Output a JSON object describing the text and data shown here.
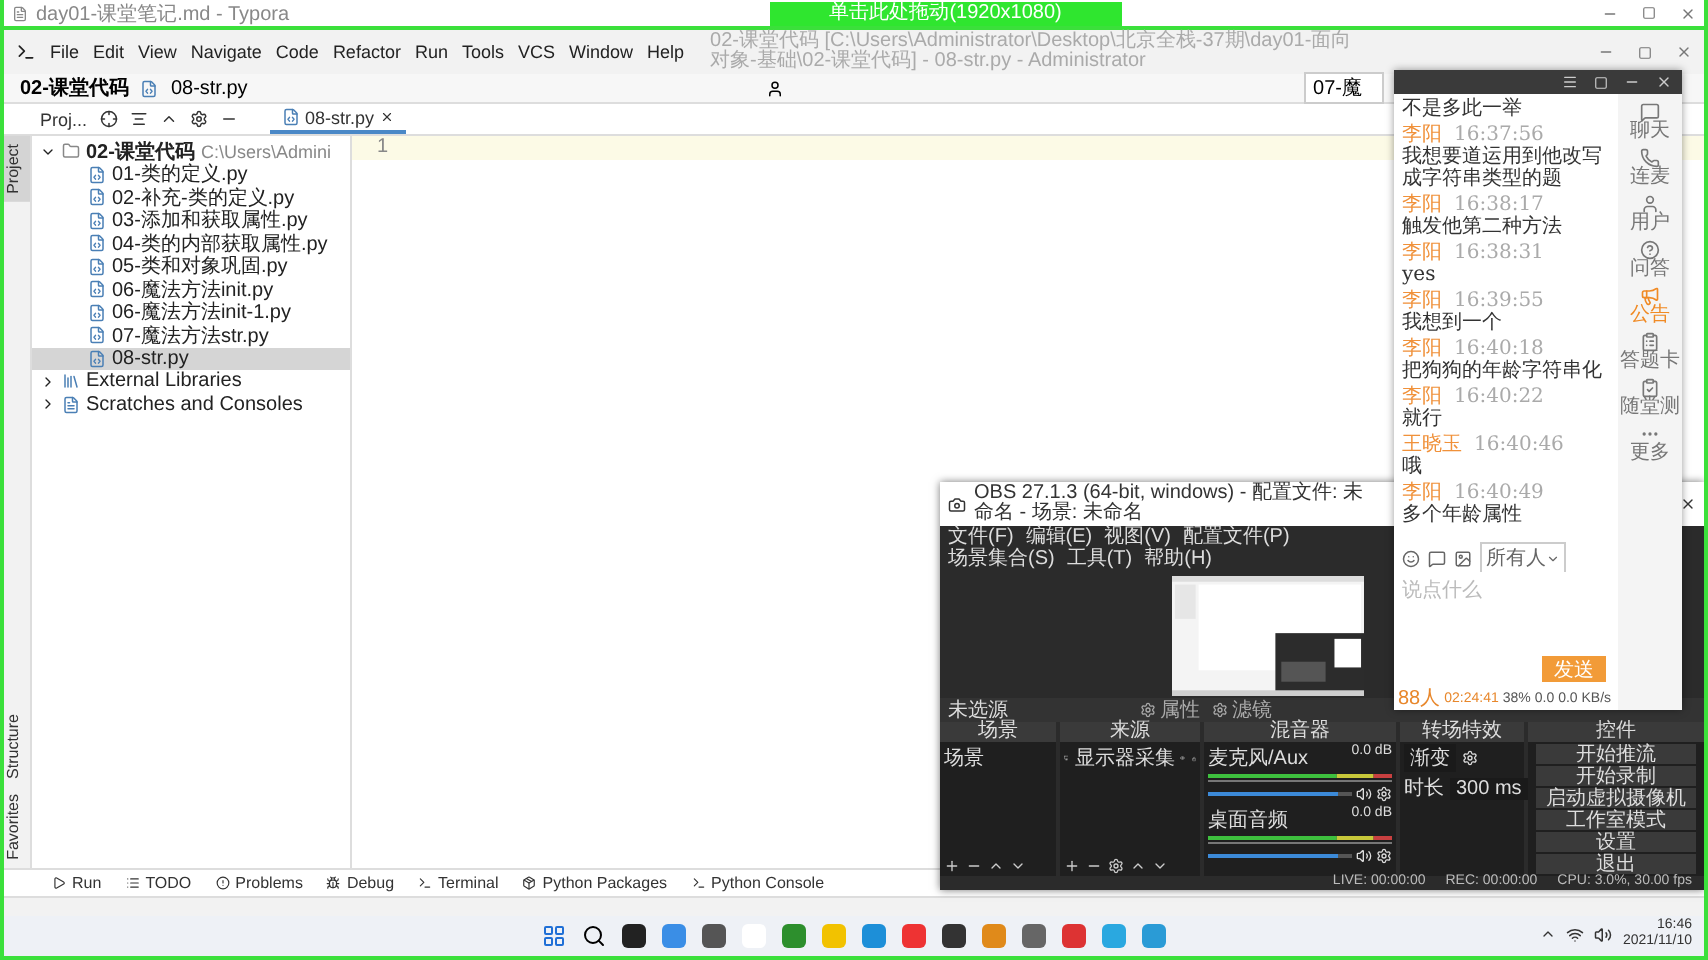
{
  "typora": {
    "title": "day01-课堂笔记.md - Typora",
    "drag_label": "单击此处拖动(1920x1080)"
  },
  "pycharm": {
    "menu": [
      "File",
      "Edit",
      "View",
      "Navigate",
      "Code",
      "Refactor",
      "Run",
      "Tools",
      "VCS",
      "Window",
      "Help"
    ],
    "title": "02-课堂代码 [C:\\Users\\Administrator\\Desktop\\北京全栈-37期\\day01-面向对象-基础\\02-课堂代码] - 08-str.py - Administrator",
    "breadcrumb": [
      "02-课堂代码",
      "08-str.py"
    ],
    "run_config": "07-魔",
    "project_label": "Proj...",
    "editor_tab": "08-str.py",
    "tree": {
      "label": "02-课堂代码",
      "path": "C:\\Users\\Admini",
      "expanded": true,
      "files": [
        {
          "label": "01-类的定义.py",
          "selected": false
        },
        {
          "label": "02-补充-类的定义.py",
          "selected": false
        },
        {
          "label": "03-添加和获取属性.py",
          "selected": false
        },
        {
          "label": "04-类的内部获取属性.py",
          "selected": false
        },
        {
          "label": "05-类和对象巩固.py",
          "selected": false
        },
        {
          "label": "06-魔法方法init.py",
          "selected": false
        },
        {
          "label": "06-魔法方法init-1.py",
          "selected": false
        },
        {
          "label": "07-魔法方法str.py",
          "selected": false
        },
        {
          "label": "08-str.py",
          "selected": true
        }
      ]
    },
    "extras": [
      {
        "kind": "library",
        "label": "External Libraries"
      },
      {
        "kind": "scratch",
        "label": "Scratches and Consoles"
      }
    ],
    "line_numbers": [
      "1"
    ],
    "side_tabs": [
      {
        "label": "Project",
        "selected": true
      },
      {
        "label": "Structure",
        "selected": false
      },
      {
        "label": "Favorites",
        "selected": false
      }
    ],
    "bottom_tabs": [
      "Run",
      "TODO",
      "Problems",
      "Debug",
      "Terminal",
      "Python Packages",
      "Python Console"
    ]
  },
  "obs": {
    "title": "OBS 27.1.3 (64-bit, windows) - 配置文件: 未命名 - 场景: 未命名",
    "menu": [
      "文件(F)",
      "编辑(E)",
      "视图(V)",
      "配置文件(P)",
      "场景集合(S)",
      "工具(T)",
      "帮助(H)"
    ],
    "source_bar": {
      "label": "未选源",
      "properties": "属性",
      "filters": "滤镜"
    },
    "docks": [
      "场景",
      "来源",
      "混音器",
      "转场特效",
      "控件"
    ],
    "scenes": [
      "场景"
    ],
    "sources": [
      "显示器采集"
    ],
    "mixer": [
      {
        "name": "麦克风/Aux",
        "reading": "0.0 dB",
        "level": 0.9
      },
      {
        "name": "桌面音频",
        "reading": "0.0 dB",
        "level": 0.9
      }
    ],
    "transition": {
      "type": "渐变",
      "duration_label": "时长",
      "duration": "300 ms"
    },
    "controls": [
      "开始推流",
      "开始录制",
      "启动虚拟摄像机",
      "工作室模式",
      "设置",
      "退出"
    ],
    "status": [
      "LIVE: 00:00:00",
      "REC: 00:00:00",
      "CPU: 3.0%, 30.00 fps"
    ]
  },
  "chat": {
    "messages": [
      {
        "text": "不是多此一举"
      },
      {
        "name": "李阳",
        "time": "16:37:56",
        "text": "我想要道运用到他改写成字符串类型的题"
      },
      {
        "name": "李阳",
        "time": "16:38:17",
        "text": "触发他第二种方法"
      },
      {
        "name": "李阳",
        "time": "16:38:31",
        "text": "yes"
      },
      {
        "name": "李阳",
        "time": "16:39:55",
        "text": "我想到一个"
      },
      {
        "name": "李阳",
        "time": "16:40:18",
        "text": "把狗狗的年龄字符串化"
      },
      {
        "name": "李阳",
        "time": "16:40:22",
        "text": "就行"
      },
      {
        "name": "王晓玉",
        "time": "16:40:46",
        "text": "哦"
      },
      {
        "name": "李阳",
        "time": "16:40:49",
        "text": "多个年龄属性"
      }
    ],
    "recipient": "所有人",
    "placeholder": "说点什么",
    "send": "发送",
    "status": {
      "people": "88人",
      "duration": "02:24:41",
      "ratio": "38%",
      "speed": "0.0 0.0 KB/s"
    },
    "tabs": [
      {
        "label": "聊天",
        "selected": false
      },
      {
        "label": "连麦",
        "selected": false
      },
      {
        "label": "用户",
        "selected": false
      },
      {
        "label": "问答",
        "selected": false
      },
      {
        "label": "公告",
        "selected": true
      },
      {
        "label": "答题卡",
        "selected": false
      },
      {
        "label": "随堂测",
        "selected": false
      },
      {
        "label": "更多",
        "selected": false
      }
    ]
  },
  "taskbar": {
    "time": "16:46",
    "date": "2021/11/10"
  }
}
